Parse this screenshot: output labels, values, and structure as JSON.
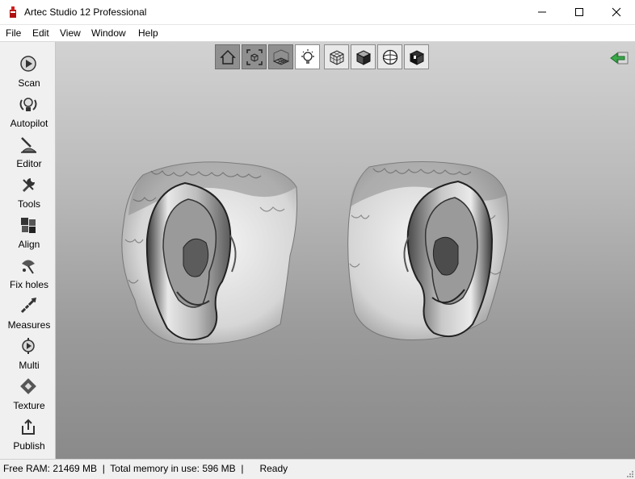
{
  "window": {
    "title": "Artec Studio 12 Professional",
    "controls": [
      "minimize",
      "maximize",
      "close"
    ]
  },
  "menu": [
    {
      "label": "File"
    },
    {
      "label": "Edit"
    },
    {
      "label": "View"
    },
    {
      "label": "Window"
    },
    {
      "label": "Help"
    }
  ],
  "sidebar": {
    "items": [
      {
        "label": "Scan",
        "icon": "scan-icon"
      },
      {
        "label": "Autopilot",
        "icon": "autopilot-icon"
      },
      {
        "label": "Editor",
        "icon": "editor-icon"
      },
      {
        "label": "Tools",
        "icon": "tools-icon"
      },
      {
        "label": "Align",
        "icon": "align-icon"
      },
      {
        "label": "Fix holes",
        "icon": "fix-holes-icon"
      },
      {
        "label": "Measures",
        "icon": "measures-icon"
      },
      {
        "label": "Multi",
        "icon": "multi-icon"
      },
      {
        "label": "Texture",
        "icon": "texture-icon"
      },
      {
        "label": "Publish",
        "icon": "publish-icon"
      }
    ]
  },
  "view_toolbar": {
    "buttons": [
      {
        "icon": "home-view-icon",
        "state": "active"
      },
      {
        "icon": "fit-view-icon",
        "state": "active"
      },
      {
        "icon": "grid-icon",
        "state": "active"
      },
      {
        "icon": "lighting-icon",
        "state": "highlight"
      },
      {
        "icon": "wireframe-icon",
        "state": "normal"
      },
      {
        "icon": "solid-shaded-icon",
        "state": "normal"
      },
      {
        "icon": "sphere-icon",
        "state": "normal"
      },
      {
        "icon": "texture-view-icon",
        "state": "normal"
      }
    ]
  },
  "status": {
    "text": "Free RAM: 21469 MB  |  Total memory in use: 596 MB  |      Ready"
  },
  "colors": {
    "titlebar_bg": "#ffffff",
    "panel_bg": "#f0f0f0",
    "viewport_top": "#d2d2d2",
    "viewport_bottom": "#8a8a8a",
    "back_arrow": "#3aa84a"
  }
}
